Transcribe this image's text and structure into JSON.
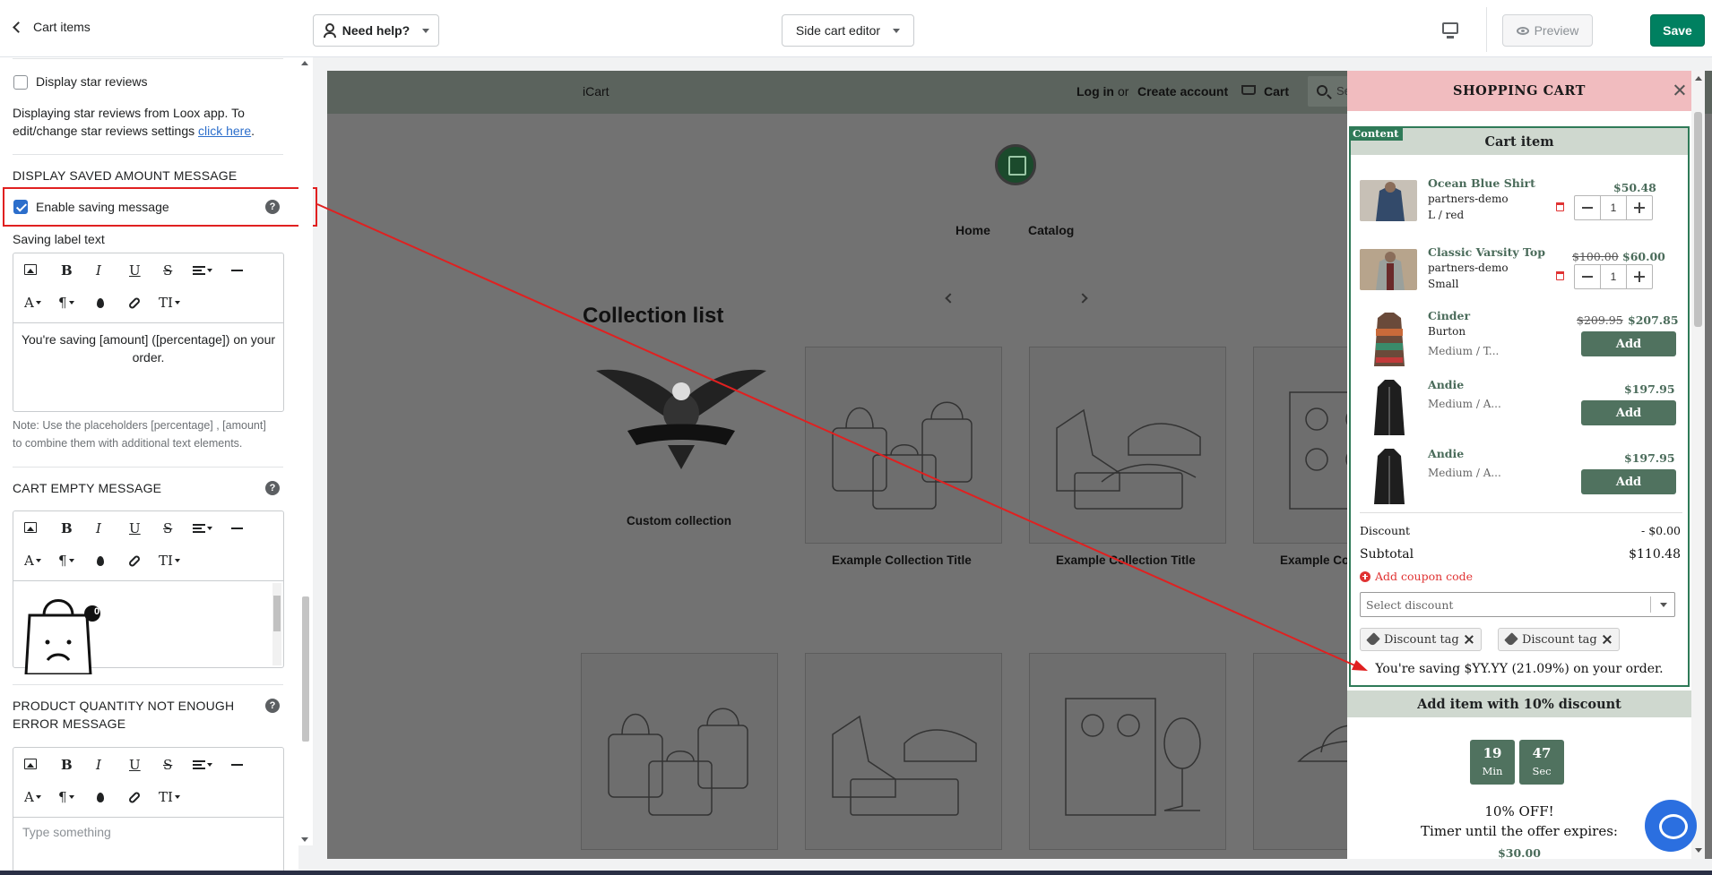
{
  "header": {
    "back_label": "Cart items",
    "help_label": "Need help?",
    "editor_label": "Side cart editor",
    "preview_label": "Preview",
    "save_label": "Save"
  },
  "sidebar": {
    "star_reviews_label": "Display star reviews",
    "star_reviews_note_1": "Displaying star reviews from Loox app. To",
    "star_reviews_note_2": "edit/change star reviews settings",
    "star_reviews_link": "click here",
    "saved_amount_heading": "DISPLAY SAVED AMOUNT MESSAGE",
    "enable_saving_label": "Enable saving message",
    "saving_label_text": "Saving label text",
    "saving_editor_text": "You're saving [amount] ([percentage]) on your order.",
    "placeholder_note_1": "Note: Use the placeholders [percentage] , [amount]",
    "placeholder_note_2": "to combine them with additional text elements.",
    "cart_empty_heading": "CART EMPTY MESSAGE",
    "empty_badge": "0",
    "qty_error_heading_1": "PRODUCT QUANTITY NOT ENOUGH",
    "qty_error_heading_2": "ERROR MESSAGE",
    "qty_error_placeholder": "Type something",
    "toolbar": {
      "bold": "B",
      "italic": "I",
      "underline": "U",
      "strike": "S",
      "font_color": "A",
      "paragraph": "¶",
      "text_size": "TI"
    },
    "help_mark": "?"
  },
  "store": {
    "brand": "iCart",
    "login": "Log in",
    "or": "or",
    "create_account": "Create account",
    "cart": "Cart",
    "search_placeholder": "Se",
    "nav_home": "Home",
    "nav_catalog": "Catalog",
    "collection_heading": "Collection list",
    "custom_collection": "Custom collection",
    "example_title_1": "Example Collection Title",
    "example_title_2": "Example Collection Title",
    "example_title_3": "Example Co"
  },
  "cart": {
    "title": "SHOPPING CART",
    "content_tag": "Content",
    "section_title": "Cart item",
    "items": [
      {
        "name": "Ocean Blue Shirt",
        "vendor": "partners-demo",
        "variant": "L / red",
        "price": "$50.48",
        "qty": "1"
      },
      {
        "name": "Classic Varsity Top",
        "vendor": "partners-demo",
        "variant": "Small",
        "old_price": "$100.00",
        "price": "$60.00",
        "qty": "1"
      }
    ],
    "upsell": [
      {
        "name": "Cinder",
        "vendor": "Burton",
        "variant": "Medium / T...",
        "old_price": "$209.95",
        "price": "$207.85",
        "button": "Add"
      },
      {
        "name": "Andie",
        "variant": "Medium / A...",
        "price": "$197.95",
        "button": "Add"
      },
      {
        "name": "Andie",
        "variant": "Medium / A...",
        "price": "$197.95",
        "button": "Add"
      }
    ],
    "discount_label": "Discount",
    "discount_value": "- $0.00",
    "subtotal_label": "Subtotal",
    "subtotal_value": "$110.48",
    "coupon_label": "Add coupon code",
    "select_placeholder": "Select discount",
    "discount_tag_1": "Discount tag",
    "discount_tag_2": "Discount tag",
    "saving_message": "You're saving $YY.YY (21.09%) on your order.",
    "add_with_discount": "Add item with 10% discount",
    "timer_min": "19",
    "timer_min_unit": "Min",
    "timer_sec": "47",
    "timer_sec_unit": "Sec",
    "offer_title": "10% OFF!",
    "offer_subtitle": "Timer until the offer expires:",
    "offer_price": "$30.00"
  },
  "colors": {
    "save_green": "#008060",
    "cart_header_pink": "#f1bcbf",
    "cart_accent_green": "#50725f",
    "annotation_red": "#e02020",
    "checkbox_blue": "#2c6ecb"
  }
}
